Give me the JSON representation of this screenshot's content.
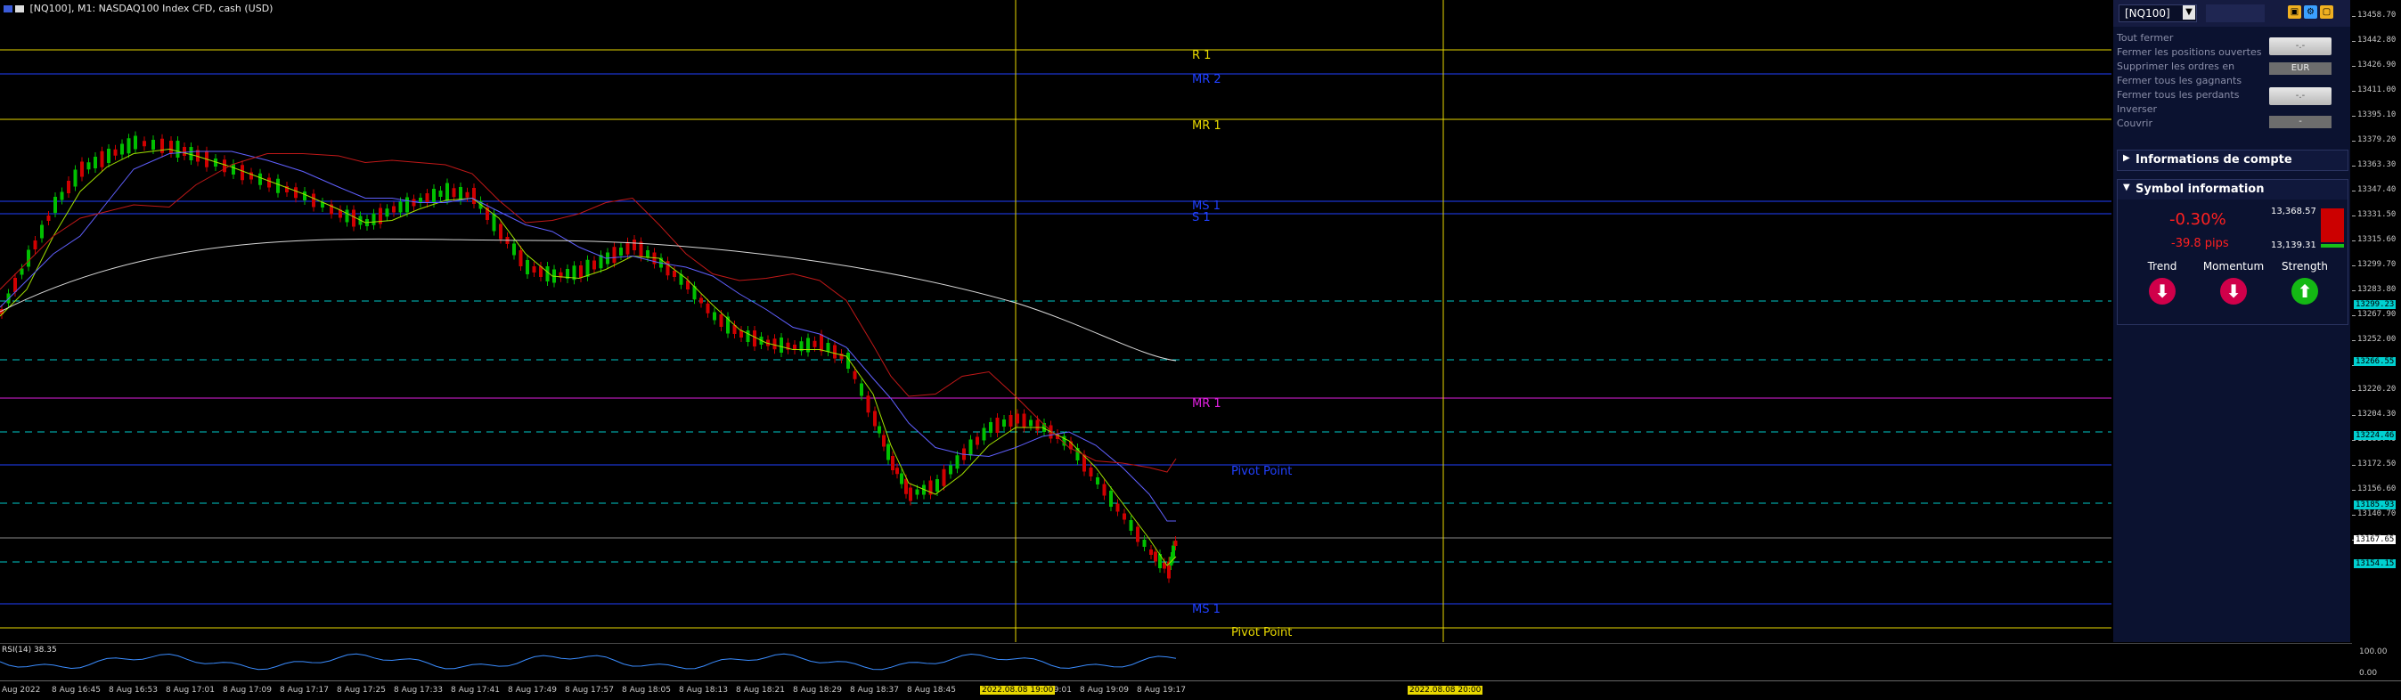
{
  "window": {
    "title": "[NQ100], M1: NASDAQ100 Index CFD, cash (USD)"
  },
  "levels": [
    {
      "label": "R 1",
      "color": "#e8d800"
    },
    {
      "label": "MR 2",
      "color": "#2040ff"
    },
    {
      "label": "MR 1",
      "color": "#e8d800"
    },
    {
      "label": "MS 1",
      "color": "#2040ff"
    },
    {
      "label": "S 1",
      "color": "#2040ff"
    },
    {
      "label": "MR 1",
      "color": "#e020e0"
    },
    {
      "label": "Pivot Point",
      "color": "#2040ff"
    },
    {
      "label": "MS 1",
      "color": "#2040ff"
    },
    {
      "label": "Pivot Point",
      "color": "#e8d800"
    }
  ],
  "price_axis": {
    "ticks": [
      "13458.70",
      "13442.80",
      "13426.90",
      "13411.00",
      "13395.10",
      "13379.20",
      "13363.30",
      "13347.40",
      "13331.50",
      "13315.60",
      "13299.70",
      "13283.80",
      "13267.90",
      "13252.00",
      "13236.10",
      "13220.20",
      "13204.30",
      "13188.40",
      "13172.50",
      "13156.60",
      "13140.70",
      "13124.80"
    ],
    "tags": [
      {
        "text": "13299.23",
        "color": "#00d0d0"
      },
      {
        "text": "13266.55",
        "color": "#00d0d0"
      },
      {
        "text": "13224.46",
        "color": "#00d0d0"
      },
      {
        "text": "13185.93",
        "color": "#00d0d0"
      },
      {
        "text": "13167.65",
        "color": "#ffffff"
      },
      {
        "text": "13154.15",
        "color": "#00d0d0"
      }
    ]
  },
  "panel": {
    "symbol": "[NQ100]",
    "menu": [
      "Tout fermer",
      "Fermer les positions ouvertes",
      "Supprimer les ordres en",
      "Fermer tous les gagnants",
      "Fermer tous les perdants",
      "Inverser",
      "Couvrir"
    ],
    "btn1": "-.-",
    "btn1_tab": "EUR",
    "btn2": "-.-",
    "btn2_tab": "-",
    "account_title": "Informations de compte",
    "symbol_info_title": "Symbol information",
    "change_pct": "-0.30%",
    "change_pips": "-39.8 pips",
    "high": "13,368.57",
    "low": "13,139.31",
    "trend_label": "Trend",
    "momentum_label": "Momentum",
    "strength_label": "Strength",
    "colors": {
      "down": "#d0004a",
      "up": "#14b814"
    }
  },
  "rsi": {
    "label": "RSI(14) 38.35",
    "scale_top": "100.00",
    "scale_bottom": "0.00"
  },
  "time_axis": {
    "labels": [
      "Aug 2022",
      "8 Aug 16:45",
      "8 Aug 16:53",
      "8 Aug 17:01",
      "8 Aug 17:09",
      "8 Aug 17:17",
      "8 Aug 17:25",
      "8 Aug 17:33",
      "8 Aug 17:41",
      "8 Aug 17:49",
      "8 Aug 17:57",
      "8 Aug 18:05",
      "8 Aug 18:13",
      "8 Aug 18:21",
      "8 Aug 18:29",
      "8 Aug 18:37",
      "8 Aug 18:45",
      "8 Aug 19:01",
      "8 Aug 19:09",
      "8 Aug 19:17"
    ],
    "highlight1": "2022.08.08 19:00",
    "highlight2": "2022.08.08 20:00"
  }
}
